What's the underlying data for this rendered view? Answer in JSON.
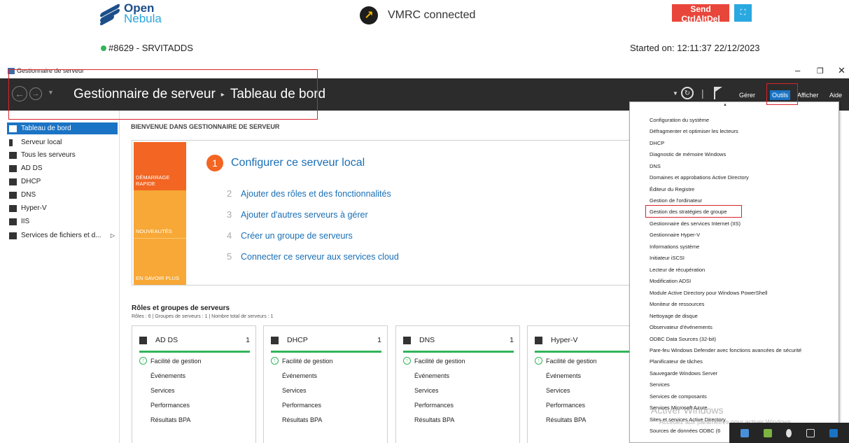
{
  "vmrc": {
    "logo_line1": "Open",
    "logo_line2": "Nebula",
    "status": "VMRC connected",
    "send_cad": "Send CtrlAltDel",
    "fullscreen_icon": "fullscreen-icon",
    "vm_name": "#8629 - SRVITADDS",
    "started": "Started on: 12:11:37 22/12/2023"
  },
  "window": {
    "title": "Gestionnaire de serveur"
  },
  "cmdbar": {
    "crumb_root": "Gestionnaire de serveur",
    "crumb_sep": "▸",
    "crumb_page": "Tableau de bord",
    "menus": [
      "Gérer",
      "Outils",
      "Afficher",
      "Aide"
    ]
  },
  "sidebar": {
    "items": [
      {
        "label": "Tableau de bord"
      },
      {
        "label": "Serveur local"
      },
      {
        "label": "Tous les serveurs"
      },
      {
        "label": "AD DS"
      },
      {
        "label": "DHCP"
      },
      {
        "label": "DNS"
      },
      {
        "label": "Hyper-V"
      },
      {
        "label": "IIS"
      },
      {
        "label": "Services de fichiers et d..."
      }
    ]
  },
  "welcome": {
    "heading": "BIENVENUE DANS GESTIONNAIRE DE SERVEUR",
    "quick_start": "DÉMARRAGE RAPIDE",
    "news": "NOUVEAUTÉS",
    "learn_more": "EN SAVOIR PLUS",
    "step1_num": "1",
    "step1": "Configurer ce serveur local",
    "steps": [
      {
        "n": "2",
        "label": "Ajouter des rôles et des fonctionnalités"
      },
      {
        "n": "3",
        "label": "Ajouter d'autres serveurs à gérer"
      },
      {
        "n": "4",
        "label": "Créer un groupe de serveurs"
      },
      {
        "n": "5",
        "label": "Connecter ce serveur aux services cloud"
      }
    ]
  },
  "roles": {
    "title": "Rôles et groupes de serveurs",
    "subtitle": "Rôles : 6  |  Groupes de serveurs : 1  |  Nombre total de serveurs : 1",
    "cards": [
      {
        "name": "AD DS",
        "count": "1",
        "rows": [
          "Facilité de gestion",
          "Événements",
          "Services",
          "Performances",
          "Résultats BPA"
        ]
      },
      {
        "name": "DHCP",
        "count": "1",
        "rows": [
          "Facilité de gestion",
          "Événements",
          "Services",
          "Performances",
          "Résultats BPA"
        ]
      },
      {
        "name": "DNS",
        "count": "1",
        "rows": [
          "Facilité de gestion",
          "Événements",
          "Services",
          "Performances",
          "Résultats BPA"
        ]
      },
      {
        "name": "Hyper-V",
        "count": "",
        "rows": [
          "Facilité de gestion",
          "Événements",
          "Services",
          "Performances",
          "Résultats BPA"
        ]
      }
    ]
  },
  "tools_menu": {
    "items": [
      "Configuration du système",
      "Défragmenter et optimiser les lecteurs",
      "DHCP",
      "Diagnostic de mémoire Windows",
      "DNS",
      "Domaines et approbations Active Directory",
      "Éditeur du Registre",
      "Gestion de l'ordinateur",
      "Gestion des stratégies de groupe",
      "Gestionnaire des services Internet (IIS)",
      "Gestionnaire Hyper-V",
      "Informations système",
      "Initiateur iSCSI",
      "Lecteur de récupération",
      "Modification ADSI",
      "Module Active Directory pour Windows PowerShell",
      "Moniteur de ressources",
      "Nettoyage de disque",
      "Observateur d'événements",
      "ODBC Data Sources (32-bit)",
      "Pare-feu Windows Defender avec fonctions avancées de sécurité",
      "Planificateur de tâches",
      "Sauvegarde Windows Server",
      "Services",
      "Services de composants",
      "Services Microsoft Azure",
      "Sites et services Active Directory",
      "Sources de données ODBC (6"
    ],
    "highlighted": "Gestion des stratégies de groupe"
  },
  "watermark": {
    "line1": "Activer Windows",
    "line2": "Accédez aux paramètres pour activer Windows."
  },
  "colors": {
    "accent": "#1a73c4",
    "orange": "#f26522",
    "amber": "#f7a836",
    "green": "#31b45a",
    "highlight_red": "#d9232d"
  }
}
